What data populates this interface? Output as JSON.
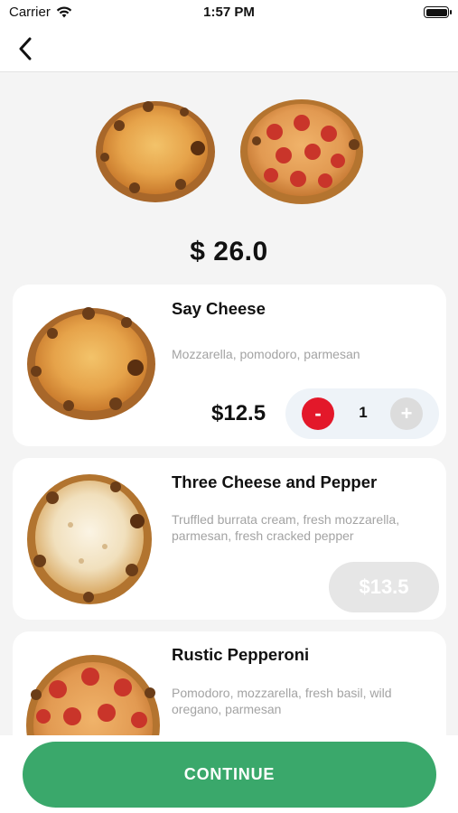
{
  "status_bar": {
    "carrier": "Carrier",
    "time": "1:57 PM"
  },
  "nav": {
    "back_icon": "chevron-left-icon"
  },
  "hero": {
    "price": "$ 26.0",
    "images": [
      "cheese-pizza",
      "pepperoni-pizza"
    ]
  },
  "items": [
    {
      "title": "Say Cheese",
      "description": "Mozzarella, pomodoro, parmesan",
      "price": "$12.5",
      "quantity": "1",
      "minus_label": "-",
      "plus_label": "+",
      "image": "cheese-pizza"
    },
    {
      "title": "Three Cheese and Pepper",
      "description": "Truffled burrata cream, fresh mozzarella, parmesan, fresh cracked pepper",
      "price": "$13.5",
      "image": "white-pizza"
    },
    {
      "title": "Rustic Pepperoni",
      "description": "Pomodoro, mozzarella, fresh basil, wild oregano, parmesan",
      "image": "pepperoni-pizza"
    }
  ],
  "footer": {
    "continue_label": "CONTINUE"
  },
  "colors": {
    "accent_green": "#3aa86b",
    "minus_red": "#e3182a",
    "disabled_gray": "#e6e6e6"
  }
}
